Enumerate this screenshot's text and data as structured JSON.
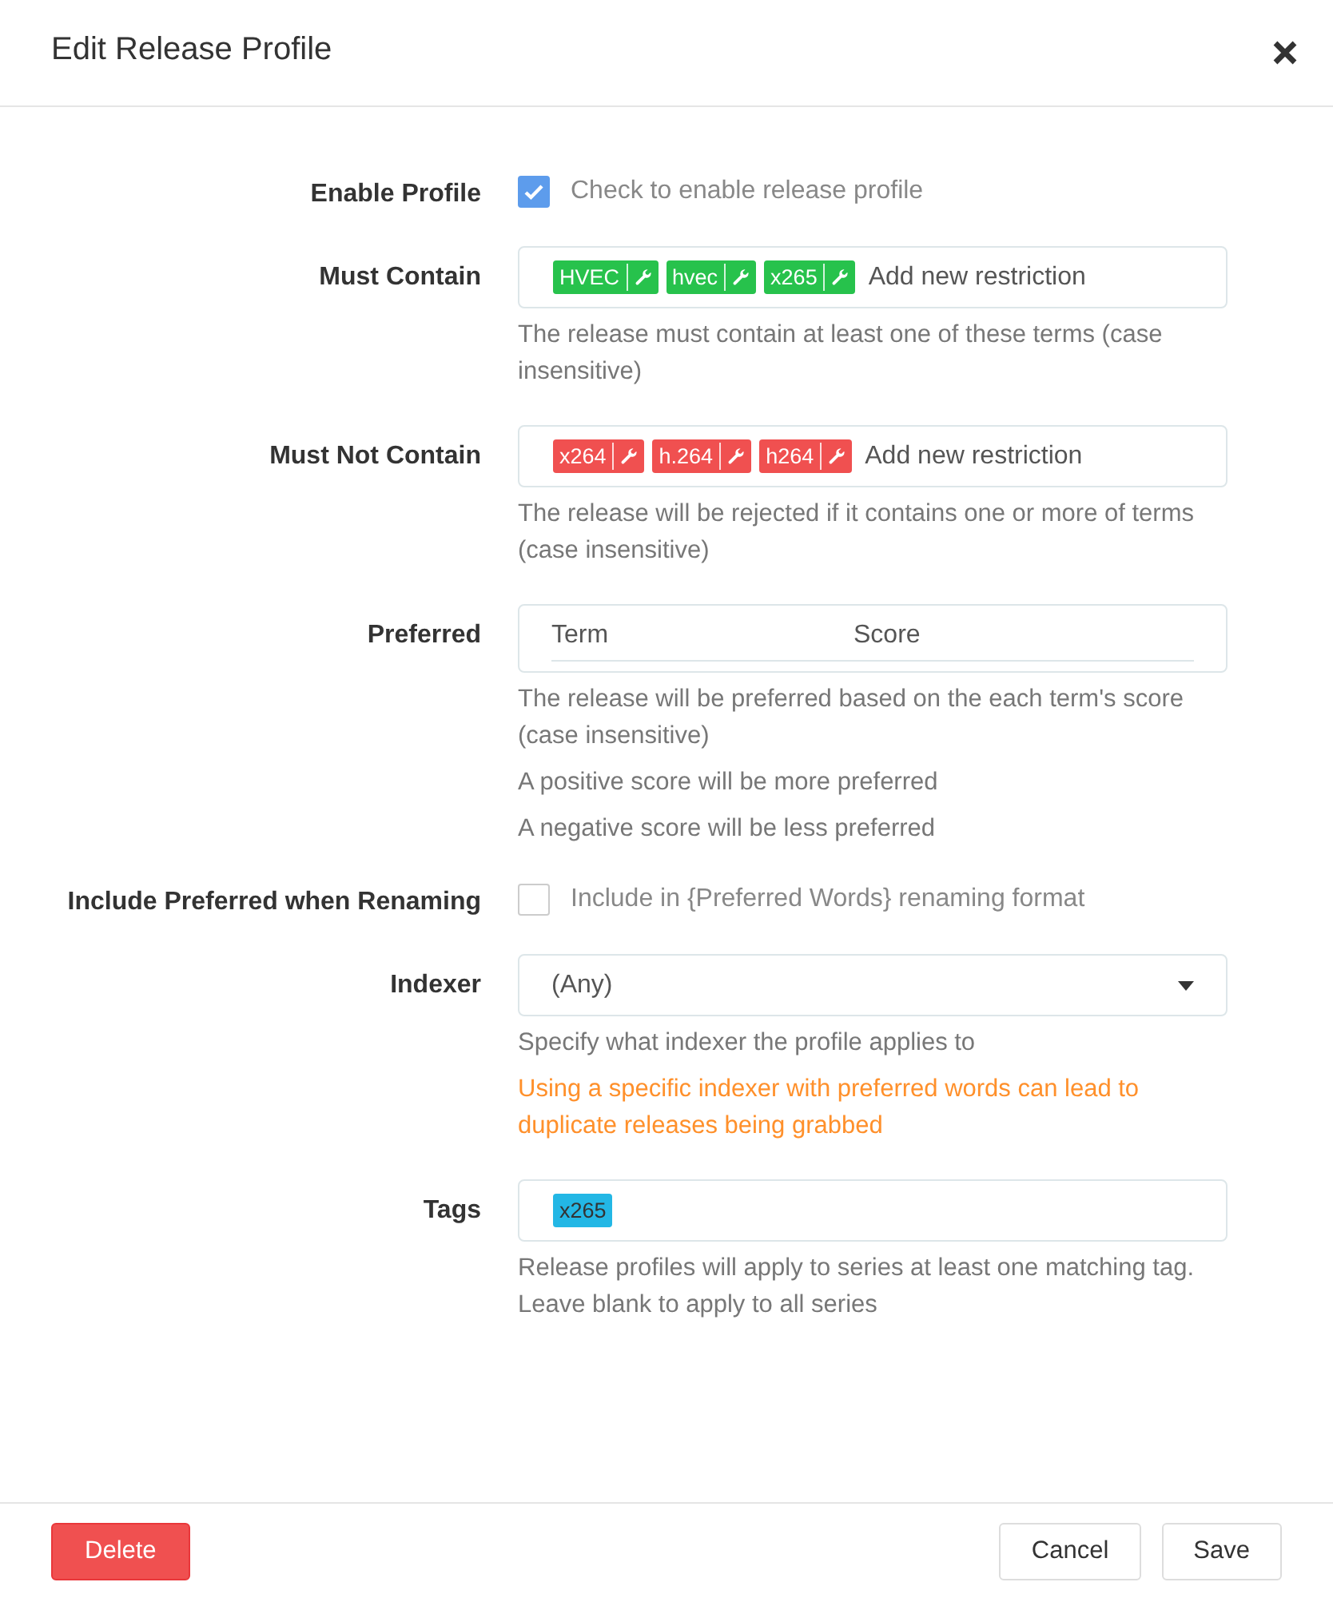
{
  "title": "Edit Release Profile",
  "fields": [
    {
      "kind": "checkbox",
      "label": "Enable Profile",
      "checked": true,
      "text": "Check to enable release profile"
    },
    {
      "kind": "terms",
      "label": "Must Contain",
      "tags": [
        {
          "text": "HVEC",
          "color": "#27c24c"
        },
        {
          "text": "hvec",
          "color": "#27c24c"
        },
        {
          "text": "x265",
          "color": "#27c24c"
        }
      ],
      "placeholder": "Add new restriction",
      "help": [
        {
          "kind": "info",
          "text": "The release must contain at least one of these terms (case insensitive)"
        }
      ]
    },
    {
      "kind": "terms",
      "label": "Must Not Contain",
      "tags": [
        {
          "text": "x264",
          "color": "#f05050"
        },
        {
          "text": "h.264",
          "color": "#f05050"
        },
        {
          "text": "h264",
          "color": "#f05050"
        }
      ],
      "placeholder": "Add new restriction",
      "help": [
        {
          "kind": "info",
          "text": "The release will be rejected if it contains one or more of terms (case insensitive)"
        }
      ]
    },
    {
      "kind": "table",
      "label": "Preferred",
      "columns": [
        "Term",
        "Score"
      ],
      "help": [
        {
          "kind": "info",
          "text": "The release will be preferred based on the each term's score (case insensitive)"
        },
        {
          "kind": "info",
          "text": "A positive score will be more preferred"
        },
        {
          "kind": "info",
          "text": "A negative score will be less preferred"
        }
      ]
    },
    {
      "kind": "checkbox",
      "label": "Include Preferred when Renaming",
      "checked": false,
      "text": "Include in {Preferred Words} renaming format"
    },
    {
      "kind": "select",
      "label": "Indexer",
      "value": "(Any)",
      "help": [
        {
          "kind": "info",
          "text": "Specify what indexer the profile applies to"
        },
        {
          "kind": "warning",
          "text": "Using a specific indexer with preferred words can lead to duplicate releases being grabbed"
        }
      ]
    },
    {
      "kind": "tags",
      "label": "Tags",
      "tags": [
        {
          "text": "x265",
          "color": "#23b7e5"
        }
      ],
      "help": [
        {
          "kind": "info",
          "text": "Release profiles will apply to series at least one matching tag. Leave blank to apply to all series"
        }
      ]
    }
  ],
  "buttons": [
    {
      "label": "Delete",
      "kind": "danger"
    },
    {
      "label": "Cancel",
      "kind": "default"
    },
    {
      "label": "Save",
      "kind": "default"
    }
  ]
}
